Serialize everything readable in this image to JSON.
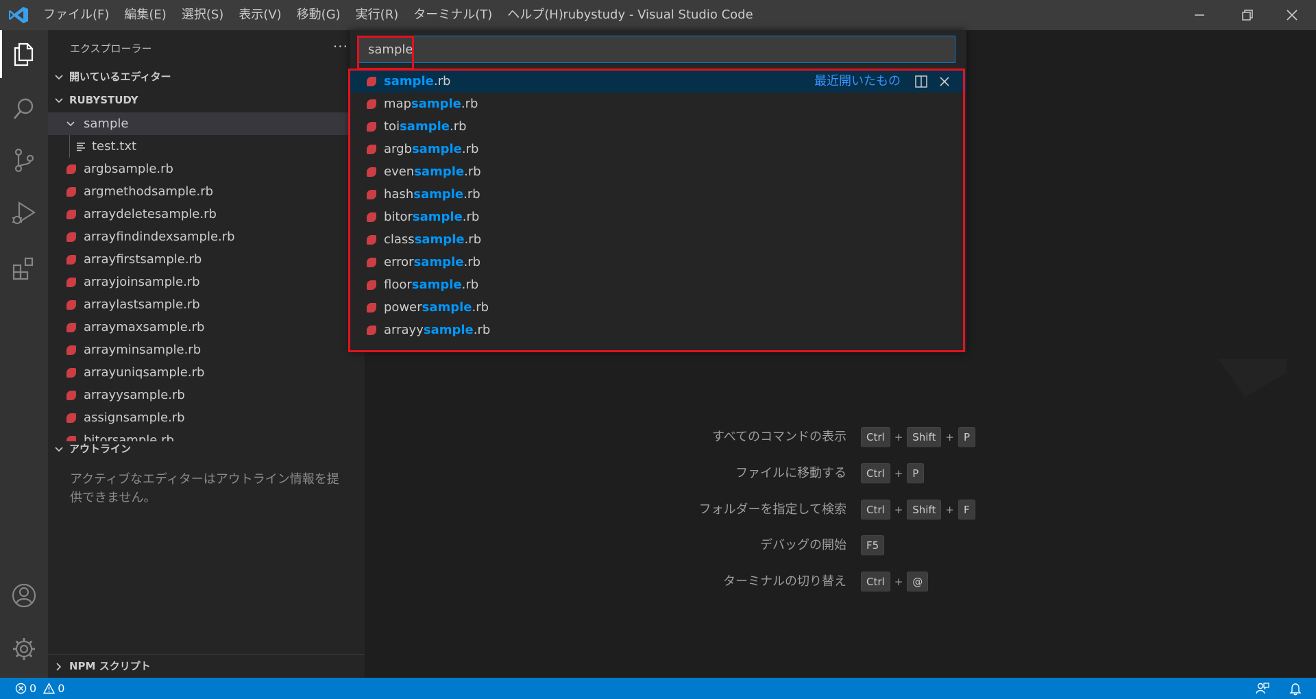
{
  "window": {
    "title": "rubystudy - Visual Studio Code",
    "menu": [
      "ファイル(F)",
      "編集(E)",
      "選択(S)",
      "表示(V)",
      "移動(G)",
      "実行(R)",
      "ターミナル(T)",
      "ヘルプ(H)"
    ]
  },
  "sidebar": {
    "title": "エクスプローラー",
    "more": "···",
    "open_editors_label": "開いているエディター",
    "workspace_label": "RUBYSTUDY",
    "folder": {
      "name": "sample",
      "children": [
        "test.txt"
      ]
    },
    "files": [
      "argbsample.rb",
      "argmethodsample.rb",
      "arraydeletesample.rb",
      "arrayfindindexsample.rb",
      "arrayfirstsample.rb",
      "arrayjoinsample.rb",
      "arraylastsample.rb",
      "arraymaxsample.rb",
      "arrayminsample.rb",
      "arrayuniqsample.rb",
      "arrayysample.rb",
      "assignsample.rb",
      "bitorsample.rb"
    ],
    "outline_label": "アウトライン",
    "outline_message": "アクティブなエディターはアウトライン情報を提供できません。",
    "npm_label": "NPM スクリプト"
  },
  "quick_open": {
    "query": "sample",
    "recent_label": "最近開いたもの",
    "items": [
      {
        "prefix": "",
        "match": "sample",
        "suffix": ".rb"
      },
      {
        "prefix": "map",
        "match": "sample",
        "suffix": ".rb"
      },
      {
        "prefix": "toi",
        "match": "sample",
        "suffix": ".rb"
      },
      {
        "prefix": "argb",
        "match": "sample",
        "suffix": ".rb"
      },
      {
        "prefix": "even",
        "match": "sample",
        "suffix": ".rb"
      },
      {
        "prefix": "hash",
        "match": "sample",
        "suffix": ".rb"
      },
      {
        "prefix": "bitor",
        "match": "sample",
        "suffix": ".rb"
      },
      {
        "prefix": "class",
        "match": "sample",
        "suffix": ".rb"
      },
      {
        "prefix": "error",
        "match": "sample",
        "suffix": ".rb"
      },
      {
        "prefix": "floor",
        "match": "sample",
        "suffix": ".rb"
      },
      {
        "prefix": "power",
        "match": "sample",
        "suffix": ".rb"
      },
      {
        "prefix": "arrayy",
        "match": "sample",
        "suffix": ".rb"
      }
    ]
  },
  "shortcuts": [
    {
      "label": "すべてのコマンドの表示",
      "keys": [
        "Ctrl",
        "Shift",
        "P"
      ]
    },
    {
      "label": "ファイルに移動する",
      "keys": [
        "Ctrl",
        "P"
      ]
    },
    {
      "label": "フォルダーを指定して検索",
      "keys": [
        "Ctrl",
        "Shift",
        "F"
      ]
    },
    {
      "label": "デバッグの開始",
      "keys": [
        "F5"
      ]
    },
    {
      "label": "ターミナルの切り替え",
      "keys": [
        "Ctrl",
        "@"
      ]
    }
  ],
  "status": {
    "errors": "0",
    "warnings": "0"
  },
  "colors": {
    "accent": "#007acc",
    "highlight": "#0097fb",
    "ruby": "#cc3e44",
    "annotation": "#e2121f"
  }
}
